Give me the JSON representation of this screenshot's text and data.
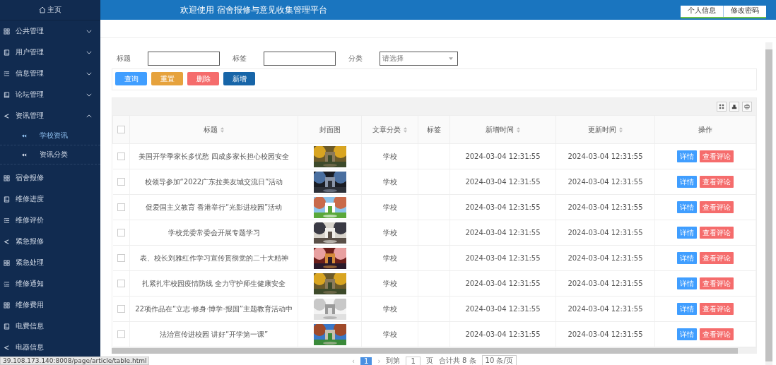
{
  "sidebar": {
    "home": "主页",
    "items": [
      {
        "label": "公共管理",
        "kind": "grid",
        "expanded": false
      },
      {
        "label": "用户管理",
        "kind": "book",
        "expanded": false
      },
      {
        "label": "信息管理",
        "kind": "list",
        "expanded": false
      },
      {
        "label": "论坛管理",
        "kind": "book",
        "expanded": false
      },
      {
        "label": "资讯管理",
        "kind": "share",
        "expanded": true,
        "children": [
          {
            "label": "学校资讯",
            "selected": true
          },
          {
            "label": "资讯分类",
            "selected": false
          }
        ]
      },
      {
        "label": "宿舍报修",
        "kind": "grid"
      },
      {
        "label": "维修进度",
        "kind": "book"
      },
      {
        "label": "维修评价",
        "kind": "list"
      },
      {
        "label": "紧急报修",
        "kind": "share"
      },
      {
        "label": "紧急处理",
        "kind": "grid"
      },
      {
        "label": "维修通知",
        "kind": "list"
      },
      {
        "label": "维修费用",
        "kind": "grid"
      },
      {
        "label": "电费信息",
        "kind": "book"
      },
      {
        "label": "电器信息",
        "kind": "share"
      }
    ]
  },
  "header": {
    "title": "欢迎使用 宿舍报修与意见收集管理平台",
    "links": [
      "个人信息",
      "修改密码"
    ]
  },
  "search": {
    "fields": [
      {
        "label": "标题",
        "kind": "text"
      },
      {
        "label": "标签",
        "kind": "text"
      },
      {
        "label": "分类",
        "kind": "select",
        "placeholder": "请选择"
      }
    ],
    "buttons": [
      {
        "label": "查询",
        "kind": "query"
      },
      {
        "label": "重置",
        "kind": "reset"
      },
      {
        "label": "删除",
        "kind": "delete"
      },
      {
        "label": "新增",
        "kind": "add"
      }
    ]
  },
  "table": {
    "columns": [
      {
        "label": "标题",
        "sortable": true
      },
      {
        "label": "封面图",
        "sortable": false
      },
      {
        "label": "文章分类",
        "sortable": true
      },
      {
        "label": "标签",
        "sortable": false
      },
      {
        "label": "新增时间",
        "sortable": true
      },
      {
        "label": "更新时间",
        "sortable": true
      },
      {
        "label": "操作",
        "sortable": false
      }
    ],
    "header_checked": false,
    "rows": [
      {
        "checked": false,
        "title": "美国开学季家长多忧愁 四成多家长担心校园安全",
        "cover": {
          "kind": "picture"
        },
        "category": "学校",
        "created": "2024-03-04 12:31:55",
        "updated": "2024-03-04 12:31:55",
        "actions": [
          "详情",
          "查看评论"
        ]
      },
      {
        "checked": false,
        "title": "校领导参加“2022广东拉美友城交流日”活动",
        "cover": {
          "kind": "picture"
        },
        "category": "学校",
        "created": "2024-03-04 12:31:55",
        "updated": "2024-03-04 12:31:55",
        "actions": [
          "详情",
          "查看评论"
        ]
      },
      {
        "checked": false,
        "title": "促爱国主义教育 香港举行“光影进校园”活动",
        "cover": {
          "kind": "picture"
        },
        "category": "学校",
        "created": "2024-03-04 12:31:55",
        "updated": "2024-03-04 12:31:55",
        "actions": [
          "详情",
          "查看评论"
        ]
      },
      {
        "checked": false,
        "title": "学校党委常委会开展专题学习",
        "cover": {
          "kind": "picture"
        },
        "category": "学校",
        "created": "2024-03-04 12:31:55",
        "updated": "2024-03-04 12:31:55",
        "actions": [
          "详情",
          "查看评论"
        ]
      },
      {
        "checked": false,
        "title": "表、校长刘雅红作学习宣传贯彻党的二十大精神",
        "cover": {
          "kind": "picture"
        },
        "category": "学校",
        "created": "2024-03-04 12:31:55",
        "updated": "2024-03-04 12:31:55",
        "actions": [
          "详情",
          "查看评论"
        ]
      },
      {
        "checked": false,
        "title": "扎紧扎牢校园疫情防线 全力守护师生健康安全",
        "cover": {
          "kind": "picture"
        },
        "category": "学校",
        "created": "2024-03-04 12:31:55",
        "updated": "2024-03-04 12:31:55",
        "actions": [
          "详情",
          "查看评论"
        ]
      },
      {
        "checked": false,
        "title": "22项作品在“立志·修身·博学·报国”主题教育活动中",
        "cover": {
          "kind": "picture"
        },
        "category": "学校",
        "created": "2024-03-04 12:31:55",
        "updated": "2024-03-04 12:31:55",
        "actions": [
          "详情",
          "查看评论"
        ]
      },
      {
        "checked": false,
        "title": "法治宣传进校园 讲好“开学第一课”",
        "cover": {
          "kind": "picture"
        },
        "category": "学校",
        "created": "2024-03-04 12:31:55",
        "updated": "2024-03-04 12:31:55",
        "actions": [
          "详情",
          "查看评论"
        ]
      }
    ]
  },
  "pagination": {
    "prev": "‹",
    "pages": [
      {
        "label": "1",
        "selected": true
      }
    ],
    "next": "›",
    "goto": "到第",
    "page_input": "1",
    "page_unit": "页",
    "total": "合计共 8 条",
    "page_size": "10 条/页"
  },
  "status_url": "39.108.173.140:8008/page/article/table.html"
}
